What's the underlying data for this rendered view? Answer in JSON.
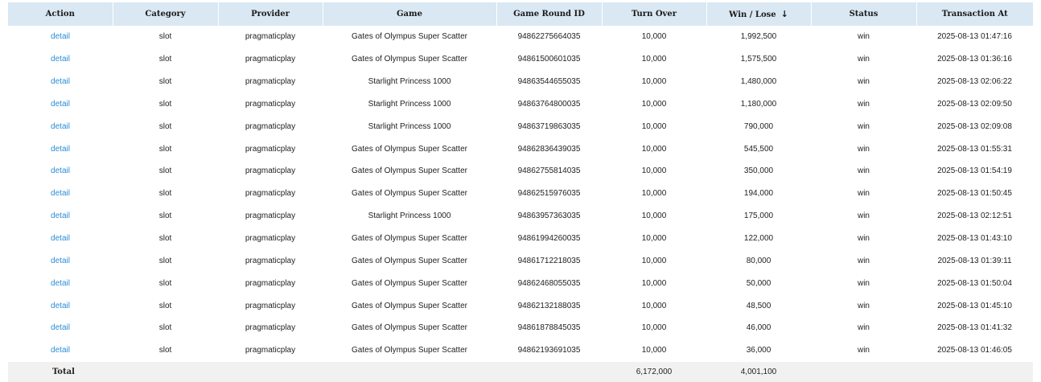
{
  "columns": {
    "action": "Action",
    "category": "Category",
    "provider": "Provider",
    "game": "Game",
    "round_id": "Game Round ID",
    "turnover": "Turn Over",
    "winlose": "Win / Lose",
    "winlose_sort_icon": "arrow-down-icon",
    "status": "Status",
    "transaction_at": "Transaction At"
  },
  "rows": [
    {
      "action": "detail",
      "category": "slot",
      "provider": "pragmaticplay",
      "game": "Gates of Olympus Super Scatter",
      "round_id": "94862275664035",
      "turnover": "10,000",
      "winlose": "1,992,500",
      "status": "win",
      "transaction_at": "2025-08-13 01:47:16"
    },
    {
      "action": "detail",
      "category": "slot",
      "provider": "pragmaticplay",
      "game": "Gates of Olympus Super Scatter",
      "round_id": "94861500601035",
      "turnover": "10,000",
      "winlose": "1,575,500",
      "status": "win",
      "transaction_at": "2025-08-13 01:36:16"
    },
    {
      "action": "detail",
      "category": "slot",
      "provider": "pragmaticplay",
      "game": "Starlight Princess 1000",
      "round_id": "94863544655035",
      "turnover": "10,000",
      "winlose": "1,480,000",
      "status": "win",
      "transaction_at": "2025-08-13 02:06:22"
    },
    {
      "action": "detail",
      "category": "slot",
      "provider": "pragmaticplay",
      "game": "Starlight Princess 1000",
      "round_id": "94863764800035",
      "turnover": "10,000",
      "winlose": "1,180,000",
      "status": "win",
      "transaction_at": "2025-08-13 02:09:50"
    },
    {
      "action": "detail",
      "category": "slot",
      "provider": "pragmaticplay",
      "game": "Starlight Princess 1000",
      "round_id": "94863719863035",
      "turnover": "10,000",
      "winlose": "790,000",
      "status": "win",
      "transaction_at": "2025-08-13 02:09:08"
    },
    {
      "action": "detail",
      "category": "slot",
      "provider": "pragmaticplay",
      "game": "Gates of Olympus Super Scatter",
      "round_id": "94862836439035",
      "turnover": "10,000",
      "winlose": "545,500",
      "status": "win",
      "transaction_at": "2025-08-13 01:55:31"
    },
    {
      "action": "detail",
      "category": "slot",
      "provider": "pragmaticplay",
      "game": "Gates of Olympus Super Scatter",
      "round_id": "94862755814035",
      "turnover": "10,000",
      "winlose": "350,000",
      "status": "win",
      "transaction_at": "2025-08-13 01:54:19"
    },
    {
      "action": "detail",
      "category": "slot",
      "provider": "pragmaticplay",
      "game": "Gates of Olympus Super Scatter",
      "round_id": "94862515976035",
      "turnover": "10,000",
      "winlose": "194,000",
      "status": "win",
      "transaction_at": "2025-08-13 01:50:45"
    },
    {
      "action": "detail",
      "category": "slot",
      "provider": "pragmaticplay",
      "game": "Starlight Princess 1000",
      "round_id": "94863957363035",
      "turnover": "10,000",
      "winlose": "175,000",
      "status": "win",
      "transaction_at": "2025-08-13 02:12:51"
    },
    {
      "action": "detail",
      "category": "slot",
      "provider": "pragmaticplay",
      "game": "Gates of Olympus Super Scatter",
      "round_id": "94861994260035",
      "turnover": "10,000",
      "winlose": "122,000",
      "status": "win",
      "transaction_at": "2025-08-13 01:43:10"
    },
    {
      "action": "detail",
      "category": "slot",
      "provider": "pragmaticplay",
      "game": "Gates of Olympus Super Scatter",
      "round_id": "94861712218035",
      "turnover": "10,000",
      "winlose": "80,000",
      "status": "win",
      "transaction_at": "2025-08-13 01:39:11"
    },
    {
      "action": "detail",
      "category": "slot",
      "provider": "pragmaticplay",
      "game": "Gates of Olympus Super Scatter",
      "round_id": "94862468055035",
      "turnover": "10,000",
      "winlose": "50,000",
      "status": "win",
      "transaction_at": "2025-08-13 01:50:04"
    },
    {
      "action": "detail",
      "category": "slot",
      "provider": "pragmaticplay",
      "game": "Gates of Olympus Super Scatter",
      "round_id": "94862132188035",
      "turnover": "10,000",
      "winlose": "48,500",
      "status": "win",
      "transaction_at": "2025-08-13 01:45:10"
    },
    {
      "action": "detail",
      "category": "slot",
      "provider": "pragmaticplay",
      "game": "Gates of Olympus Super Scatter",
      "round_id": "94861878845035",
      "turnover": "10,000",
      "winlose": "46,000",
      "status": "win",
      "transaction_at": "2025-08-13 01:41:32"
    },
    {
      "action": "detail",
      "category": "slot",
      "provider": "pragmaticplay",
      "game": "Gates of Olympus Super Scatter",
      "round_id": "94862193691035",
      "turnover": "10,000",
      "winlose": "36,000",
      "status": "win",
      "transaction_at": "2025-08-13 01:46:05"
    }
  ],
  "footer": {
    "label": "Total",
    "turnover_total": "6,172,000",
    "winlose_total": "4,001,100"
  },
  "colors": {
    "header_bg": "#d9e8f3",
    "link": "#2a8dd8",
    "footer_bg": "#f1f1f1"
  }
}
